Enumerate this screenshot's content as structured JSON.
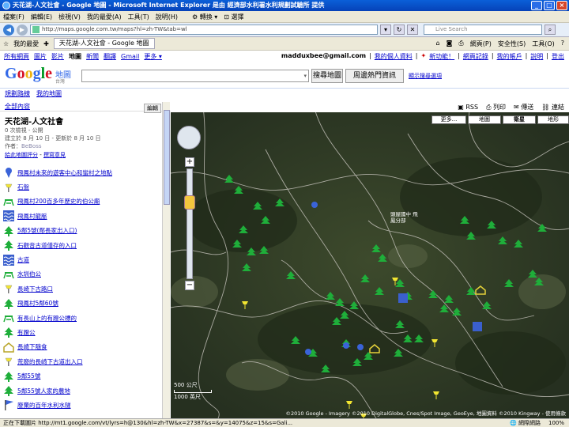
{
  "window": {
    "title": "天花湖-人文社會 - Google 地圖 - Microsoft Internet Explorer 是由 經濟部水利署水利規劃試驗所 提供"
  },
  "menubar": {
    "items": [
      "檔案(F)",
      "編輯(E)",
      "檢視(V)",
      "我的最愛(A)",
      "工具(T)",
      "說明(H)"
    ],
    "convert_label": "轉換",
    "select_label": "選擇"
  },
  "addressbar": {
    "url": "http://maps.google.com.tw/maps?hl=zh-TW&tab=wl",
    "search_placeholder": "Live Search"
  },
  "favbar": {
    "favorites_label": "我的最愛",
    "tab_label": "天花湖-人文社會 - Google 地圖",
    "page_label": "網頁(P)",
    "safety_label": "安全性(S)",
    "tools_label": "工具(O)"
  },
  "gbar": {
    "left": [
      "所有網頁",
      "圖片",
      "影片",
      "地圖",
      "新聞",
      "翻譯",
      "Gmail",
      "更多 ▾"
    ],
    "active": "地圖",
    "email": "madduxbee@gmail.com",
    "right": [
      "我的個人資料",
      "新功能！",
      "網頁記錄",
      "我的帳戶",
      "說明",
      "登出"
    ],
    "new_feature": "新功能！"
  },
  "search": {
    "logo": [
      "G",
      "o",
      "o",
      "g",
      "l",
      "e"
    ],
    "product": "地圖",
    "region": "台灣",
    "search_button": "搜尋地圖",
    "nearby_button": "周邊熱門資訊",
    "options_link": "顯示搜尋選項"
  },
  "sublinks": [
    "規劃路線",
    "我的地圖"
  ],
  "sidebar": {
    "back_link": "全部內容",
    "edit_button": "編輯",
    "map_title": "天花湖-人文社會",
    "views": "0 次檢視 - 公開",
    "dates": "建立於 8 月 10 日 - 更新於 8 月 10 日",
    "author_label": "作者：",
    "author": "BeBoss",
    "rate_link": "給此地圖評分",
    "review_link": "撰寫意見",
    "places": [
      {
        "icon": "blue-pin-icon",
        "label": "飛鳳村未來的遊客中心和蠻村之地點"
      },
      {
        "icon": "yellow-pushpin-icon",
        "label": "石盤"
      },
      {
        "icon": "picnic-table-icon",
        "label": "飛鳳村200百多年歷史的伯公廟"
      },
      {
        "icon": "water-icon",
        "label": "飛鳳村龍脈"
      },
      {
        "icon": "tree-icon",
        "label": "5鄰5號(鄰長家出入口)"
      },
      {
        "icon": "tree-icon",
        "label": "石觀音古道僅存的入口"
      },
      {
        "icon": "water-icon",
        "label": "古道"
      },
      {
        "icon": "picnic-table-icon",
        "label": "水圳伯公"
      },
      {
        "icon": "yellow-pushpin-icon",
        "label": "長崎下古路口"
      },
      {
        "icon": "tree-icon",
        "label": "飛鳳村5鄰60號"
      },
      {
        "icon": "picnic-table-icon",
        "label": "有長山上的有蹬公標的"
      },
      {
        "icon": "tree-icon",
        "label": "有蹬公"
      },
      {
        "icon": "house-icon",
        "label": "長崎下隨食"
      },
      {
        "icon": "yellow-pushpin-icon",
        "label": "荒廢的長崎下古道出入口"
      },
      {
        "icon": "tree-icon",
        "label": "5鄰55號"
      },
      {
        "icon": "tree-icon",
        "label": "5鄰55號人家的農地"
      },
      {
        "icon": "blue-flag-icon",
        "label": "廢棄的百年水利水隧"
      }
    ]
  },
  "map": {
    "toolbar": [
      "RSS",
      "列印",
      "傳送",
      "連結"
    ],
    "types": [
      "更多...",
      "地圖",
      "衛星",
      "地形"
    ],
    "selected_type": "衛星",
    "scale_metric": "500 公尺",
    "scale_imperial": "1000 英尺",
    "copyright": "©2010 Google - Imagery ©2010 DigitalGlobe, Cnes/Spot Image, GeoEye, 地圖資料 ©2010 Kingway - 使用條款",
    "label_village": "頭屋國中 飛鳳分部",
    "colors": {
      "tree": "#1fae3a",
      "pin": "#3a63d8",
      "pushpin": "#f2e531",
      "water": "#3a5fcd",
      "table": "#1fae3a"
    }
  },
  "statusbar": {
    "text": "正在下載圖片 http://mt1.google.com/vt/lyrs=h@130&hl=zh-TW&x=27387&s=&y=14075&z=15&s=Gali...",
    "zone": "網際網路",
    "zoom": "100%"
  }
}
